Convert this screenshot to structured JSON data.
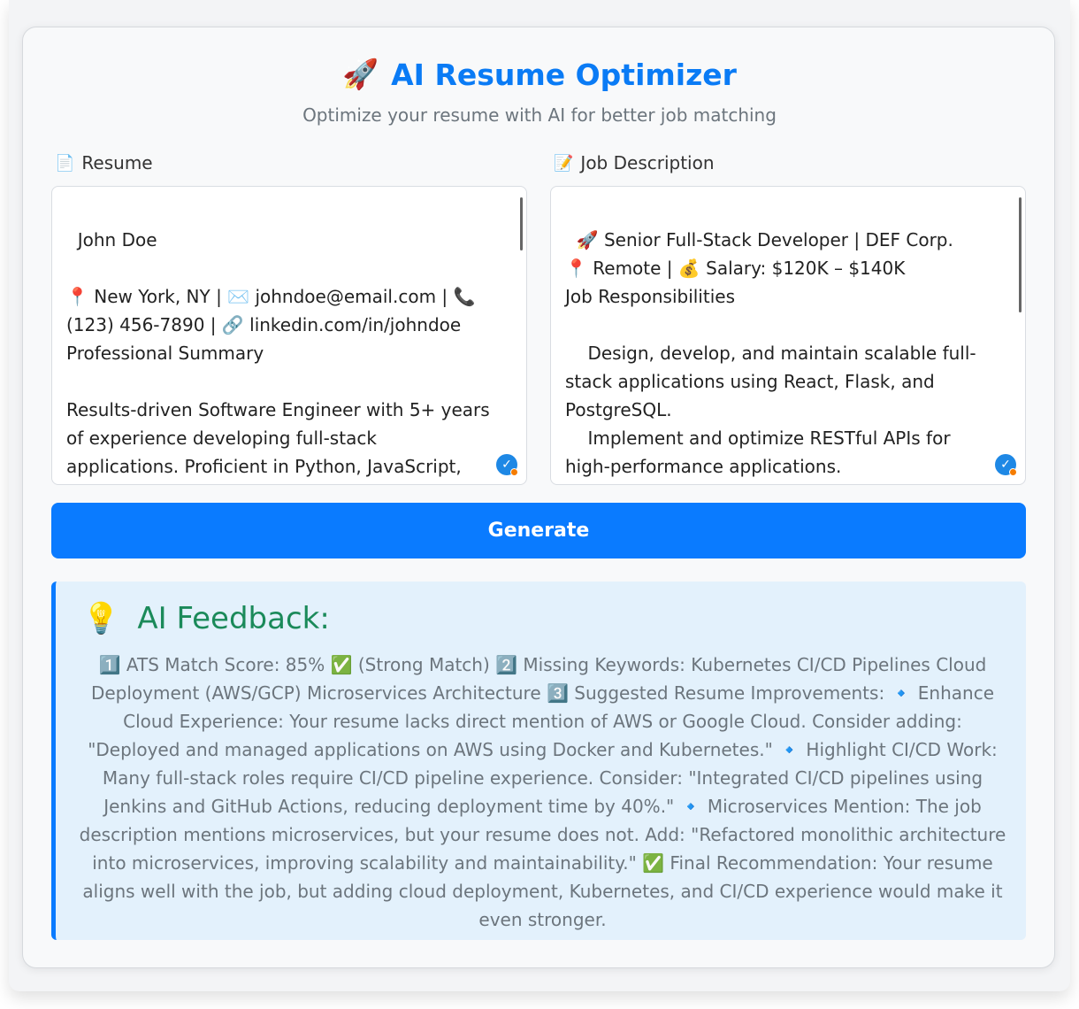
{
  "header": {
    "title": "AI Resume Optimizer",
    "title_icon": "🚀",
    "subtitle": "Optimize your resume with AI for better job matching"
  },
  "resume": {
    "label": "Resume",
    "icon": "📄",
    "value": "John Doe\n\n📍 New York, NY | ✉️ johndoe@email.com | 📞 (123) 456-7890 | 🔗 linkedin.com/in/johndoe\nProfessional Summary\n\nResults-driven Software Engineer with 5+ years of experience developing full-stack applications. Proficient in Python, JavaScript, React, Flask, and PostgreSQL. Passionate about optimizing code"
  },
  "job": {
    "label": "Job Description",
    "icon": "📝",
    "value": "🚀 Senior Full-Stack Developer | DEF Corp.\n📍 Remote | 💰 Salary: $120K – $140K\nJob Responsibilities\n\n    Design, develop, and maintain scalable full-stack applications using React, Flask, and PostgreSQL.\n    Implement and optimize RESTful APIs for high-performance applications.\n    Work in an Agile environment, collaborating with cross-functional teams."
  },
  "generate_label": "Generate",
  "feedback": {
    "icon": "💡",
    "title": "AI Feedback:",
    "body": "1️⃣ ATS Match Score: 85% ✅ (Strong Match) 2️⃣ Missing Keywords: Kubernetes CI/CD Pipelines Cloud Deployment (AWS/GCP) Microservices Architecture 3️⃣ Suggested Resume Improvements: 🔹 Enhance Cloud Experience: Your resume lacks direct mention of AWS or Google Cloud. Consider adding: \"Deployed and managed applications on AWS using Docker and Kubernetes.\" 🔹 Highlight CI/CD Work: Many full-stack roles require CI/CD pipeline experience. Consider: \"Integrated CI/CD pipelines using Jenkins and GitHub Actions, reducing deployment time by 40%.\" 🔹 Microservices Mention: The job description mentions microservices, but your resume does not. Add: \"Refactored monolithic architecture into microservices, improving scalability and maintainability.\" ✅ Final Recommendation: Your resume aligns well with the job, but adding cloud deployment, Kubernetes, and CI/CD experience would make it even stronger."
  }
}
